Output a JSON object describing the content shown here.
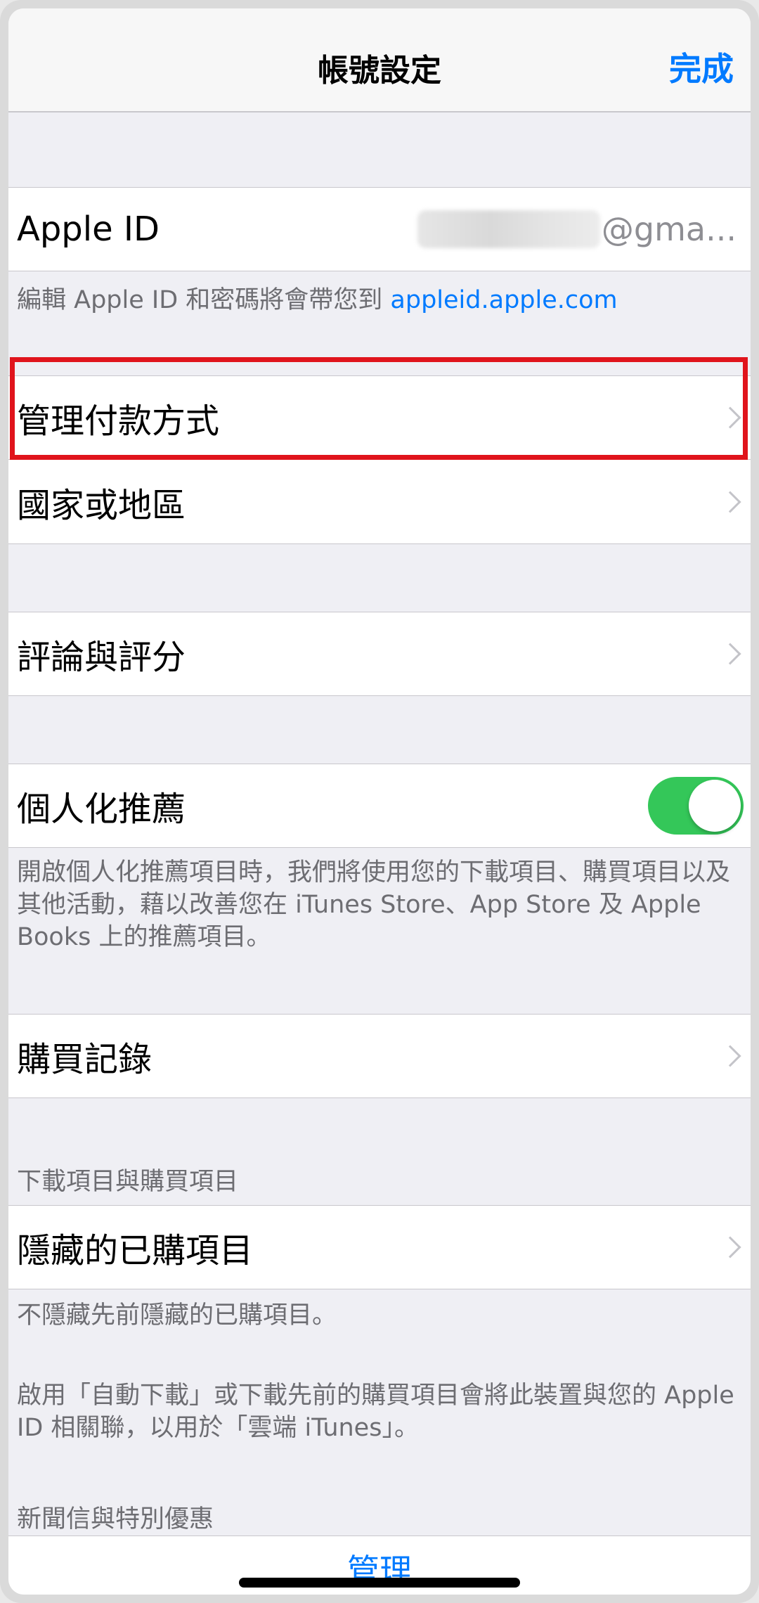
{
  "nav": {
    "title": "帳號設定",
    "done": "完成"
  },
  "apple_id": {
    "label": "Apple ID",
    "value_suffix": "@gma..."
  },
  "apple_id_note": {
    "text": "編輯 Apple ID 和密碼將會帶您到 ",
    "link": "appleid.apple.com"
  },
  "rows": {
    "payment": "管理付款方式",
    "country": "國家或地區",
    "ratings": "評論與評分",
    "personalized": "個人化推薦",
    "purchase_history": "購買記錄",
    "hidden_purchases": "隱藏的已購項目"
  },
  "personalized_toggle": {
    "on": true,
    "color": "#34c759"
  },
  "personalized_note": "開啟個人化推薦項目時，我們將使用您的下載項目、購買項目以及其他活動，藉以改善您在 iTunes Store、App Store 及 Apple Books 上的推薦項目。",
  "downloads_header": "下載項目與購買項目",
  "hidden_note": "不隱藏先前隱藏的已購項目。",
  "auto_download_note": "啟用「自動下載」或下載先前的購買項目會將此裝置與您的 Apple ID 相關聯，以用於「雲端 iTunes」。",
  "newsletter_header": "新聞信與特別優惠",
  "manage": "管理",
  "colors": {
    "accent": "#007aff",
    "highlight": "#e0141c",
    "background": "#efeff4"
  }
}
